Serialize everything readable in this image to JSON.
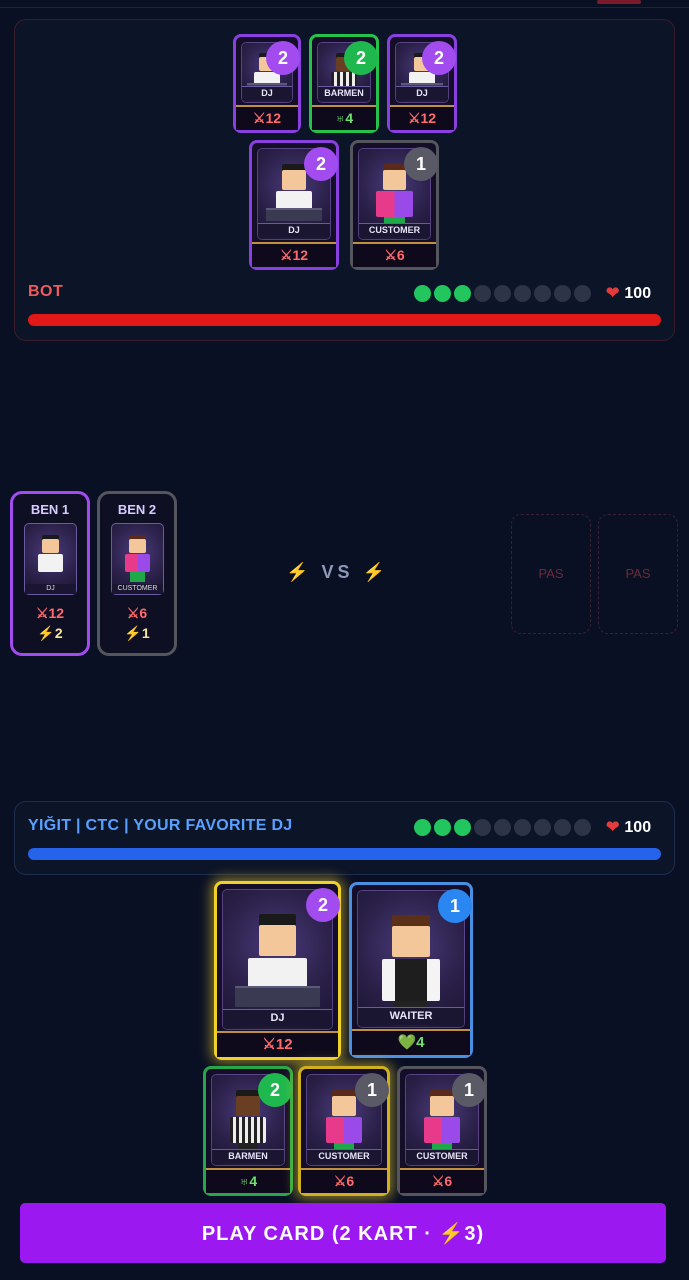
{
  "bot": {
    "name": "BOT",
    "hp": "100",
    "energy_on": 3,
    "energy_total": 9,
    "bar_color": "#e01818",
    "cards": [
      {
        "name": "DJ",
        "cost": "2",
        "stat": "⚔12",
        "stat_type": "attack",
        "border": "#8a3fe0",
        "badge": "purple"
      },
      {
        "name": "BARMEN",
        "cost": "2",
        "stat": "♅4",
        "stat_type": "heal",
        "border": "#26c24a",
        "badge": "green"
      },
      {
        "name": "DJ",
        "cost": "2",
        "stat": "⚔12",
        "stat_type": "attack",
        "border": "#8a3fe0",
        "badge": "purple"
      },
      {
        "name": "DJ",
        "cost": "2",
        "stat": "⚔12",
        "stat_type": "attack",
        "border": "#8a3fe0",
        "badge": "purple"
      },
      {
        "name": "CUSTOMER",
        "cost": "1",
        "stat": "⚔6",
        "stat_type": "attack",
        "border": "#55555e",
        "badge": "gray"
      }
    ]
  },
  "battle": {
    "slots": [
      {
        "title": "BEN 1",
        "card": "DJ",
        "atk": "⚔12",
        "energy": "⚡2",
        "border": "#a24cf0"
      },
      {
        "title": "BEN 2",
        "card": "CUSTOMER",
        "atk": "⚔6",
        "energy": "⚡1",
        "border": "#55555e"
      }
    ],
    "vs": "VS",
    "opponent_slots": [
      "PAS",
      "PAS"
    ]
  },
  "player": {
    "name": "YIĞIT | CTC | YOUR FAVORITE DJ",
    "hp": "100",
    "energy_on": 3,
    "energy_total": 9,
    "bar_color": "#2563eb",
    "cards": [
      {
        "name": "DJ",
        "cost": "2",
        "stat": "⚔12",
        "stat_type": "attack",
        "border": "#8a3fe0",
        "badge": "purple",
        "selected": true
      },
      {
        "name": "WAITER",
        "cost": "1",
        "stat": "💚4",
        "stat_type": "heal",
        "border": "#4a90e2",
        "badge": "blue",
        "selected": false
      },
      {
        "name": "BARMEN",
        "cost": "2",
        "stat": "♅4",
        "stat_type": "heal",
        "border": "#26a84a",
        "badge": "green",
        "selected": false
      },
      {
        "name": "CUSTOMER",
        "cost": "1",
        "stat": "⚔6",
        "stat_type": "attack",
        "border": "#d0b020",
        "badge": "gray",
        "selected": true
      },
      {
        "name": "CUSTOMER",
        "cost": "1",
        "stat": "⚔6",
        "stat_type": "attack",
        "border": "#55555e",
        "badge": "gray",
        "selected": false
      }
    ]
  },
  "play_button": "PLAY CARD (2 KART · ⚡3)",
  "icons": {
    "heart": "heart-icon",
    "bolt": "lightning-icon",
    "sword": "sword-icon"
  }
}
